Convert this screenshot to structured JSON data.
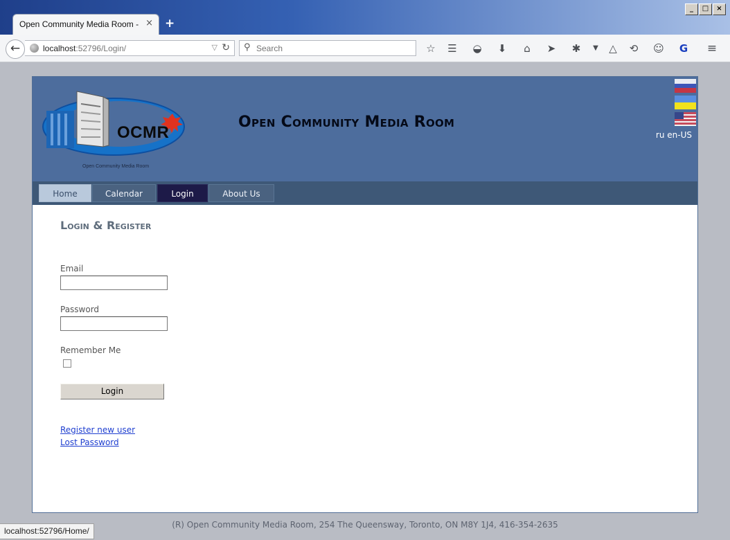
{
  "browser": {
    "window_buttons": [
      "_",
      "□",
      "×"
    ],
    "tab_title": "Open Community Media Room - Lo...",
    "tab_close": "×",
    "new_tab": "+",
    "url_host": "localhost",
    "url_rest": ":52796/Login/",
    "search_placeholder": "Search",
    "status_url": "localhost:52796/Home/"
  },
  "header": {
    "logo_text": "OCMR",
    "logo_caption": "Open Community Media Room",
    "site_title": "Open Community Media Room",
    "languages": [
      "ru",
      "en-US"
    ]
  },
  "menu": {
    "items": [
      {
        "label": "Home",
        "state": "home"
      },
      {
        "label": "Calendar",
        "state": "normal"
      },
      {
        "label": "Login",
        "state": "active"
      },
      {
        "label": "About Us",
        "state": "normal"
      }
    ]
  },
  "login": {
    "title": "Login & Register",
    "email_label": "Email",
    "email_value": "",
    "password_label": "Password",
    "password_value": "",
    "remember_label": "Remember Me",
    "remember_checked": false,
    "submit_label": "Login",
    "register_link": "Register new user",
    "lost_password_link": "Lost Password"
  },
  "footer": {
    "text": "(R) Open Community Media Room, 254 The Queensway, Toronto, ON M8Y 1J4, 416-354-2635"
  },
  "colors": {
    "header_bg": "#4d6d9d",
    "menu_bg": "#3e5877",
    "active_menu": "#1d1a48",
    "link": "#1f3fd0"
  }
}
